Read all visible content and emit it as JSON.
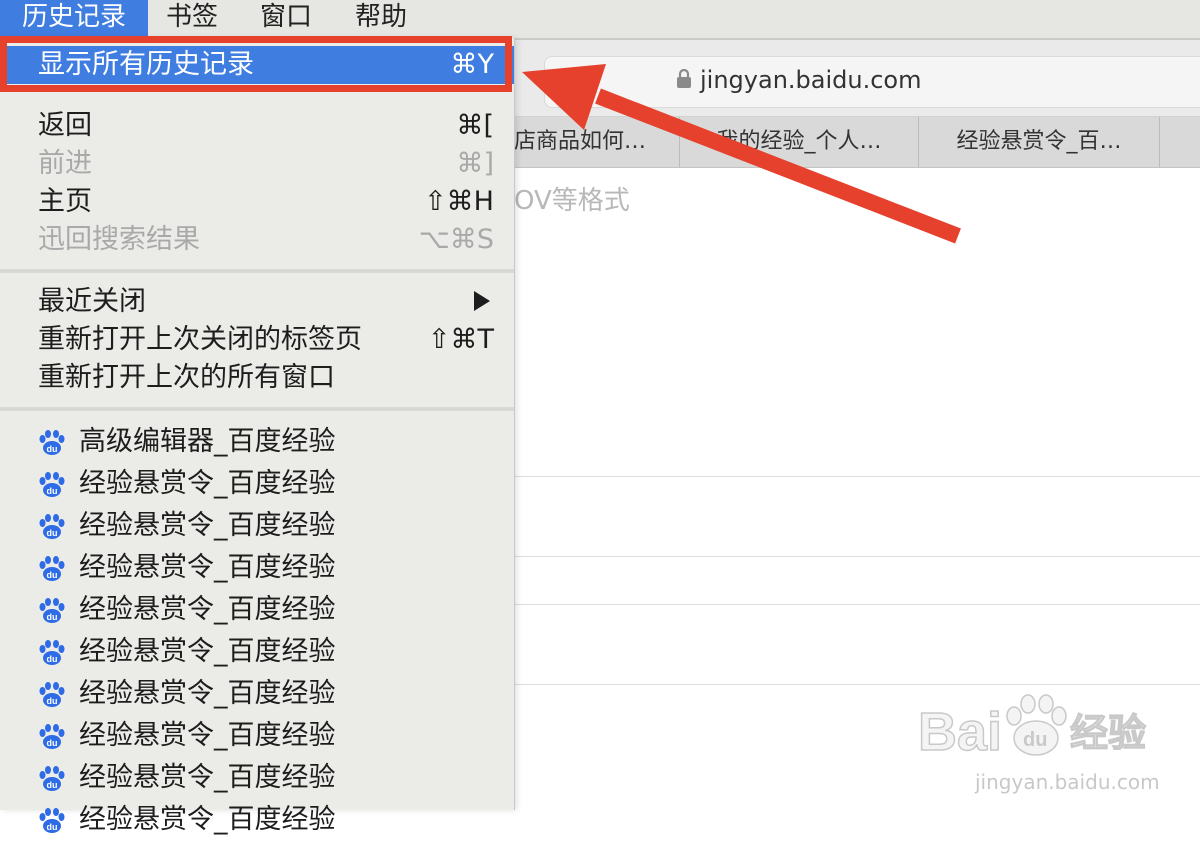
{
  "menubar": {
    "items": [
      "历史记录",
      "书签",
      "窗口",
      "帮助"
    ]
  },
  "browser": {
    "url": "jingyan.baidu.com",
    "tabs": [
      "店商品如何…",
      "我的经验_个人…",
      "经验悬赏令_百…"
    ],
    "ghost_text": "OV等格式"
  },
  "menu": {
    "show_all": {
      "label": "显示所有历史记录",
      "shortcut": "⌘Y"
    },
    "nav": [
      {
        "label": "返回",
        "shortcut": "⌘[",
        "disabled": false
      },
      {
        "label": "前进",
        "shortcut": "⌘]",
        "disabled": true
      },
      {
        "label": "主页",
        "shortcut": "⇧⌘H",
        "disabled": false
      },
      {
        "label": "迅回搜索结果",
        "shortcut": "⌥⌘S",
        "disabled": true
      }
    ],
    "recent": [
      {
        "label": "最近关闭",
        "shortcut": ""
      },
      {
        "label": "重新打开上次关闭的标签页",
        "shortcut": "⇧⌘T"
      },
      {
        "label": "重新打开上次的所有窗口",
        "shortcut": ""
      }
    ],
    "history": [
      "高级编辑器_百度经验",
      "经验悬赏令_百度经验",
      "经验悬赏令_百度经验",
      "经验悬赏令_百度经验",
      "经验悬赏令_百度经验",
      "经验悬赏令_百度经验",
      "经验悬赏令_百度经验",
      "经验悬赏令_百度经验",
      "经验悬赏令_百度经验",
      "经验悬赏令_百度经验"
    ]
  },
  "watermark": {
    "logo": "Baidu经验",
    "url": "jingyan.baidu.com"
  },
  "colors": {
    "highlight": "#3f7de0",
    "annotation_red": "#e5412d",
    "baidu_blue": "#2e6be6"
  }
}
